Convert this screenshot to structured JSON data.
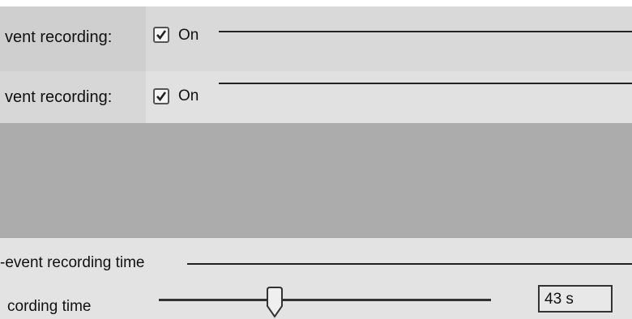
{
  "rows": [
    {
      "label": "vent recording:",
      "checkbox_label": "On",
      "checked": true
    },
    {
      "label": "vent recording:",
      "checkbox_label": "On",
      "checked": true
    }
  ],
  "section": {
    "title": "-event recording time"
  },
  "slider": {
    "label": "cording time",
    "value_text": "43 s"
  },
  "icons": {
    "checkbox_check": "check-icon",
    "slider_thumb": "slider-thumb-icon"
  }
}
